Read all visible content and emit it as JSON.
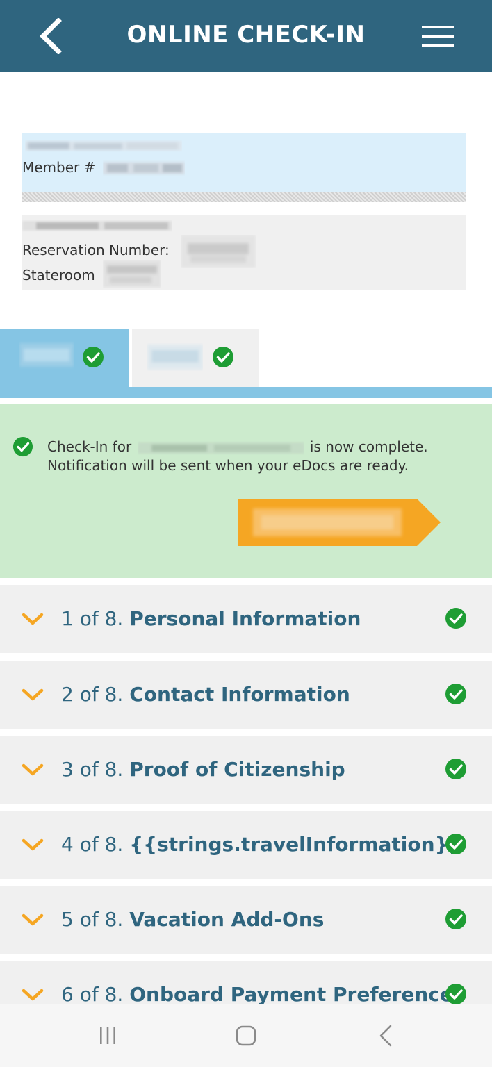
{
  "header": {
    "title": "ONLINE CHECK-IN",
    "back_icon": "chevron-left-icon",
    "menu_icon": "hamburger-menu-icon",
    "color": "#2f657f"
  },
  "member": {
    "label": "Member #"
  },
  "reservation": {
    "number_label": "Reservation Number:",
    "stateroom_label": "Stateroom"
  },
  "tabs": {
    "active_color": "#85c5e4",
    "status_icon": "check-circle-icon"
  },
  "notice": {
    "prefix": "Check-In for",
    "suffix": "is now complete.",
    "line2": "Notification will be sent when your eDocs are ready.",
    "background": "#ccebcd"
  },
  "steps": [
    {
      "number": "1 of 8.",
      "title": "Personal Information"
    },
    {
      "number": "2 of 8.",
      "title": "Contact Information"
    },
    {
      "number": "3 of 8.",
      "title": "Proof of Citizenship"
    },
    {
      "number": "4 of 8.",
      "title": "{{strings.travelInformation}}"
    },
    {
      "number": "5 of 8.",
      "title": "Vacation Add-Ons"
    },
    {
      "number": "6 of 8.",
      "title": "Onboard Payment Preferences"
    }
  ],
  "colors": {
    "accent_orange": "#f5a623",
    "success_green": "#1e9d34",
    "step_text": "#2f657f"
  },
  "navbar": {
    "recent_icon": "recent-apps-icon",
    "home_icon": "home-icon",
    "back_icon": "back-icon"
  }
}
